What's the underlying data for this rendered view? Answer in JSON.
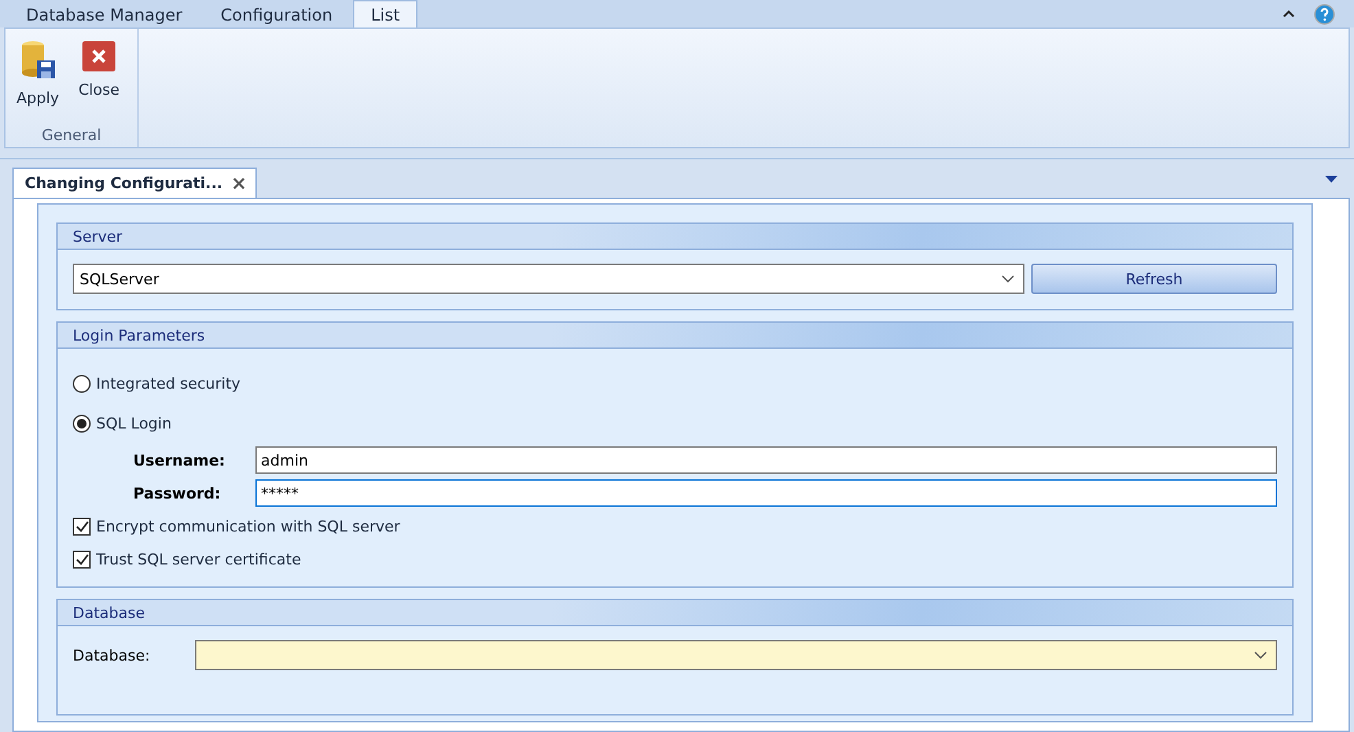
{
  "ribbon": {
    "tabs": [
      {
        "label": "Database Manager",
        "selected": false
      },
      {
        "label": "Configuration",
        "selected": false
      },
      {
        "label": "List",
        "selected": true
      }
    ],
    "buttons": [
      {
        "kind": "apply",
        "label": "Apply"
      },
      {
        "kind": "close",
        "label": "Close"
      }
    ],
    "group_label": "General"
  },
  "document_tab": {
    "title": "Changing Configurati...",
    "close": "×"
  },
  "server": {
    "title": "Server",
    "value": "SQLServer",
    "button": "Refresh"
  },
  "login": {
    "title": "Login Parameters",
    "options": [
      {
        "label": "Integrated security",
        "selected": false
      },
      {
        "label": "SQL Login",
        "selected": true
      }
    ],
    "username_label": "Username:",
    "username": "admin",
    "password_label": "Password:",
    "password": "*****",
    "checks": [
      {
        "label": "Encrypt communication with SQL server",
        "checked": true
      },
      {
        "label": "Trust SQL server certificate",
        "checked": true
      }
    ]
  },
  "database": {
    "title": "Database",
    "label": "Database:"
  }
}
